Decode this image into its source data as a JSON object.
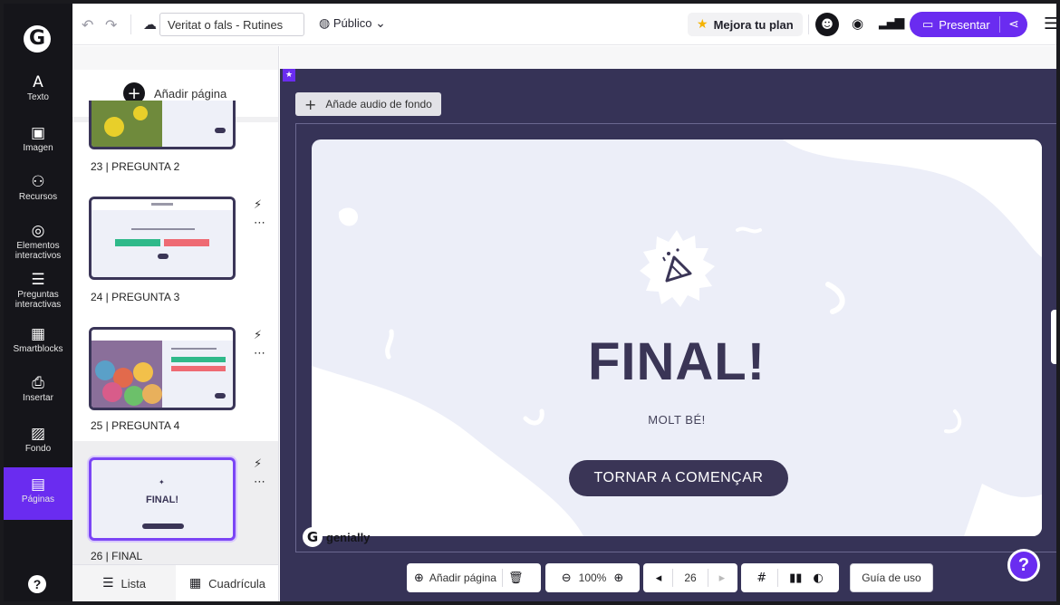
{
  "topbar": {
    "undo_icon": "undo-icon",
    "redo_icon": "redo-icon",
    "doc_title": "Veritat o fals - Rutines",
    "visibility": "Público",
    "upgrade": "Mejora tu plan",
    "present": "Presentar"
  },
  "rail": {
    "items": [
      {
        "label": "Texto",
        "icon": "A"
      },
      {
        "label": "Imagen",
        "icon": "▣"
      },
      {
        "label": "Recursos",
        "icon": "⚇"
      },
      {
        "label": "Elementos interactivos",
        "icon": "◎"
      },
      {
        "label": "Preguntas interactivas",
        "icon": "☰"
      },
      {
        "label": "Smartblocks",
        "icon": "▦"
      },
      {
        "label": "Insertar",
        "icon": "⎙"
      },
      {
        "label": "Fondo",
        "icon": "▨"
      },
      {
        "label": "Páginas",
        "icon": "▤"
      }
    ],
    "help": "?"
  },
  "panel": {
    "add_page": "Añadir página",
    "pages": [
      {
        "label": "23 | PREGUNTA 2"
      },
      {
        "label": "24 | PREGUNTA 3"
      },
      {
        "label": "25 | PREGUNTA 4"
      },
      {
        "label": "26 | FINAL",
        "thumb_title": "FINAL!"
      }
    ],
    "footer": {
      "list": "Lista",
      "grid": "Cuadrícula"
    }
  },
  "canvas": {
    "audio": "Añade audio de fondo",
    "slide": {
      "title": "FINAL!",
      "subtitle": "MOLT BÉ!",
      "button": "TORNAR A COMENÇAR"
    },
    "brand": "genially"
  },
  "bottom_toolbar": {
    "add_page": "Añadir página",
    "zoom": "100%",
    "page_number": "26",
    "guide": "Guía de uso"
  },
  "colors": {
    "accent": "#6a2cf0",
    "stage": "#363357",
    "slide_bg": "#eceef8",
    "slide_text": "#3a3556"
  }
}
